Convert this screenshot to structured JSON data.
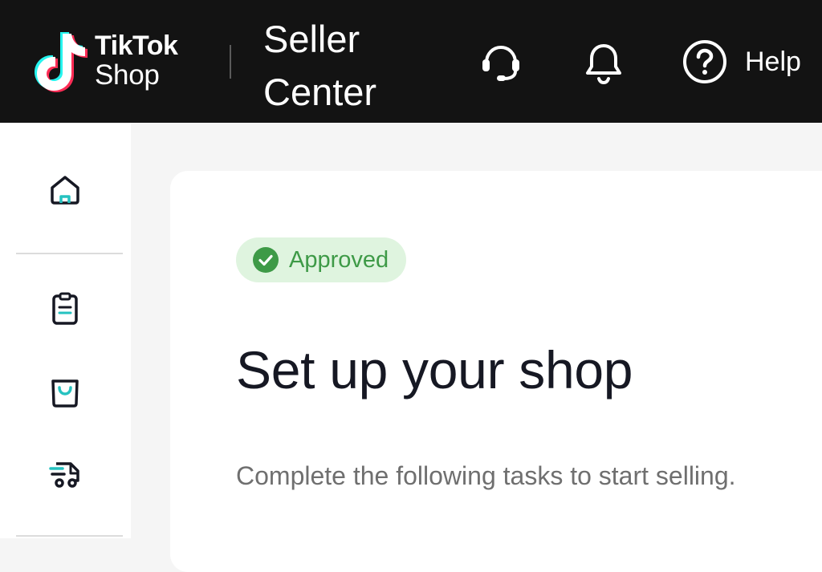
{
  "header": {
    "brand_line1": "TikTok",
    "brand_line2": "Shop",
    "product_line1": "Seller",
    "product_line2": "Center",
    "icons": [
      "customer-support-icon",
      "notification-bell-icon",
      "help-question-icon"
    ],
    "help_label": "Help"
  },
  "sidebar": {
    "items": [
      {
        "icon": "home-icon"
      },
      {
        "icon": "orders-clipboard-icon"
      },
      {
        "icon": "products-bag-icon"
      },
      {
        "icon": "shipping-truck-icon"
      }
    ]
  },
  "main": {
    "status_badge": "Approved",
    "title": "Set up your shop",
    "subtitle": "Complete the following tasks to start selling."
  },
  "colors": {
    "topbar_bg": "#131313",
    "accent_teal": "#25c2c0",
    "accent_pink": "#fe2c55",
    "approved_bg": "#dff4df",
    "approved_text": "#3e9a47"
  }
}
